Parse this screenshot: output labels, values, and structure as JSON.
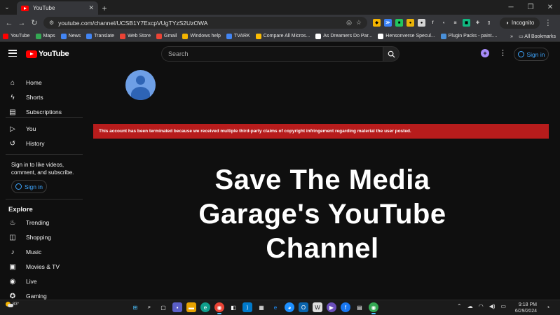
{
  "browser": {
    "tab_title": "YouTube",
    "url": "youtube.com/channel/UCSB1Y7ExcpVUgTYzS2UzOWA",
    "incognito_label": "Incognito",
    "bookmarks": [
      {
        "label": "YouTube",
        "color": "#ff0000"
      },
      {
        "label": "Maps",
        "color": "#34a853"
      },
      {
        "label": "News",
        "color": "#4285f4"
      },
      {
        "label": "Translate",
        "color": "#4285f4"
      },
      {
        "label": "Web Store",
        "color": "#ea4335"
      },
      {
        "label": "Gmail",
        "color": "#ea4335"
      },
      {
        "label": "Windows help",
        "color": "#f4b400"
      },
      {
        "label": "TVARK",
        "color": "#4285f4"
      },
      {
        "label": "Compare All Micros...",
        "color": "#fbbc04"
      },
      {
        "label": "As Dreamers Do Par...",
        "color": "#ffffff"
      },
      {
        "label": "Hensonverse Specul...",
        "color": "#ffffff"
      },
      {
        "label": "Plugin Packs - paint....",
        "color": "#4a90d9"
      }
    ],
    "all_bookmarks_label": "All Bookmarks"
  },
  "youtube": {
    "logo_text": "YouTube",
    "search_placeholder": "Search",
    "signin_label": "Sign in",
    "sidebar": {
      "primary": [
        {
          "label": "Home",
          "icon": "home-icon",
          "glyph": "⌂"
        },
        {
          "label": "Shorts",
          "icon": "shorts-icon",
          "glyph": "ϟ"
        },
        {
          "label": "Subscriptions",
          "icon": "subscriptions-icon",
          "glyph": "▤"
        }
      ],
      "secondary": [
        {
          "label": "You",
          "icon": "you-icon",
          "glyph": "▷"
        },
        {
          "label": "History",
          "icon": "history-icon",
          "glyph": "↺"
        }
      ],
      "signin_prompt": "Sign in to like videos, comment, and subscribe.",
      "signin_label": "Sign in",
      "explore_heading": "Explore",
      "explore": [
        {
          "label": "Trending",
          "icon": "trending-icon",
          "glyph": "♨"
        },
        {
          "label": "Shopping",
          "icon": "shopping-icon",
          "glyph": "◫"
        },
        {
          "label": "Music",
          "icon": "music-icon",
          "glyph": "♪"
        },
        {
          "label": "Movies & TV",
          "icon": "movies-icon",
          "glyph": "▣"
        },
        {
          "label": "Live",
          "icon": "live-icon",
          "glyph": "◉"
        },
        {
          "label": "Gaming",
          "icon": "gaming-icon",
          "glyph": "✪"
        }
      ]
    },
    "termination_notice": "This account has been terminated because we received multiple third-party claims of copyright infringement regarding material the user posted.",
    "overlay_headline": "Save The Media Garage's YouTube Channel"
  },
  "taskbar": {
    "temperature": "83°",
    "time": "9:18 PM",
    "date": "6/29/2024"
  },
  "colors": {
    "alert_red": "#b71c1c",
    "yt_red": "#ff0000",
    "link_blue": "#3ea6ff",
    "avatar_light": "#6e9fe6",
    "avatar_dark": "#2e64b5"
  }
}
